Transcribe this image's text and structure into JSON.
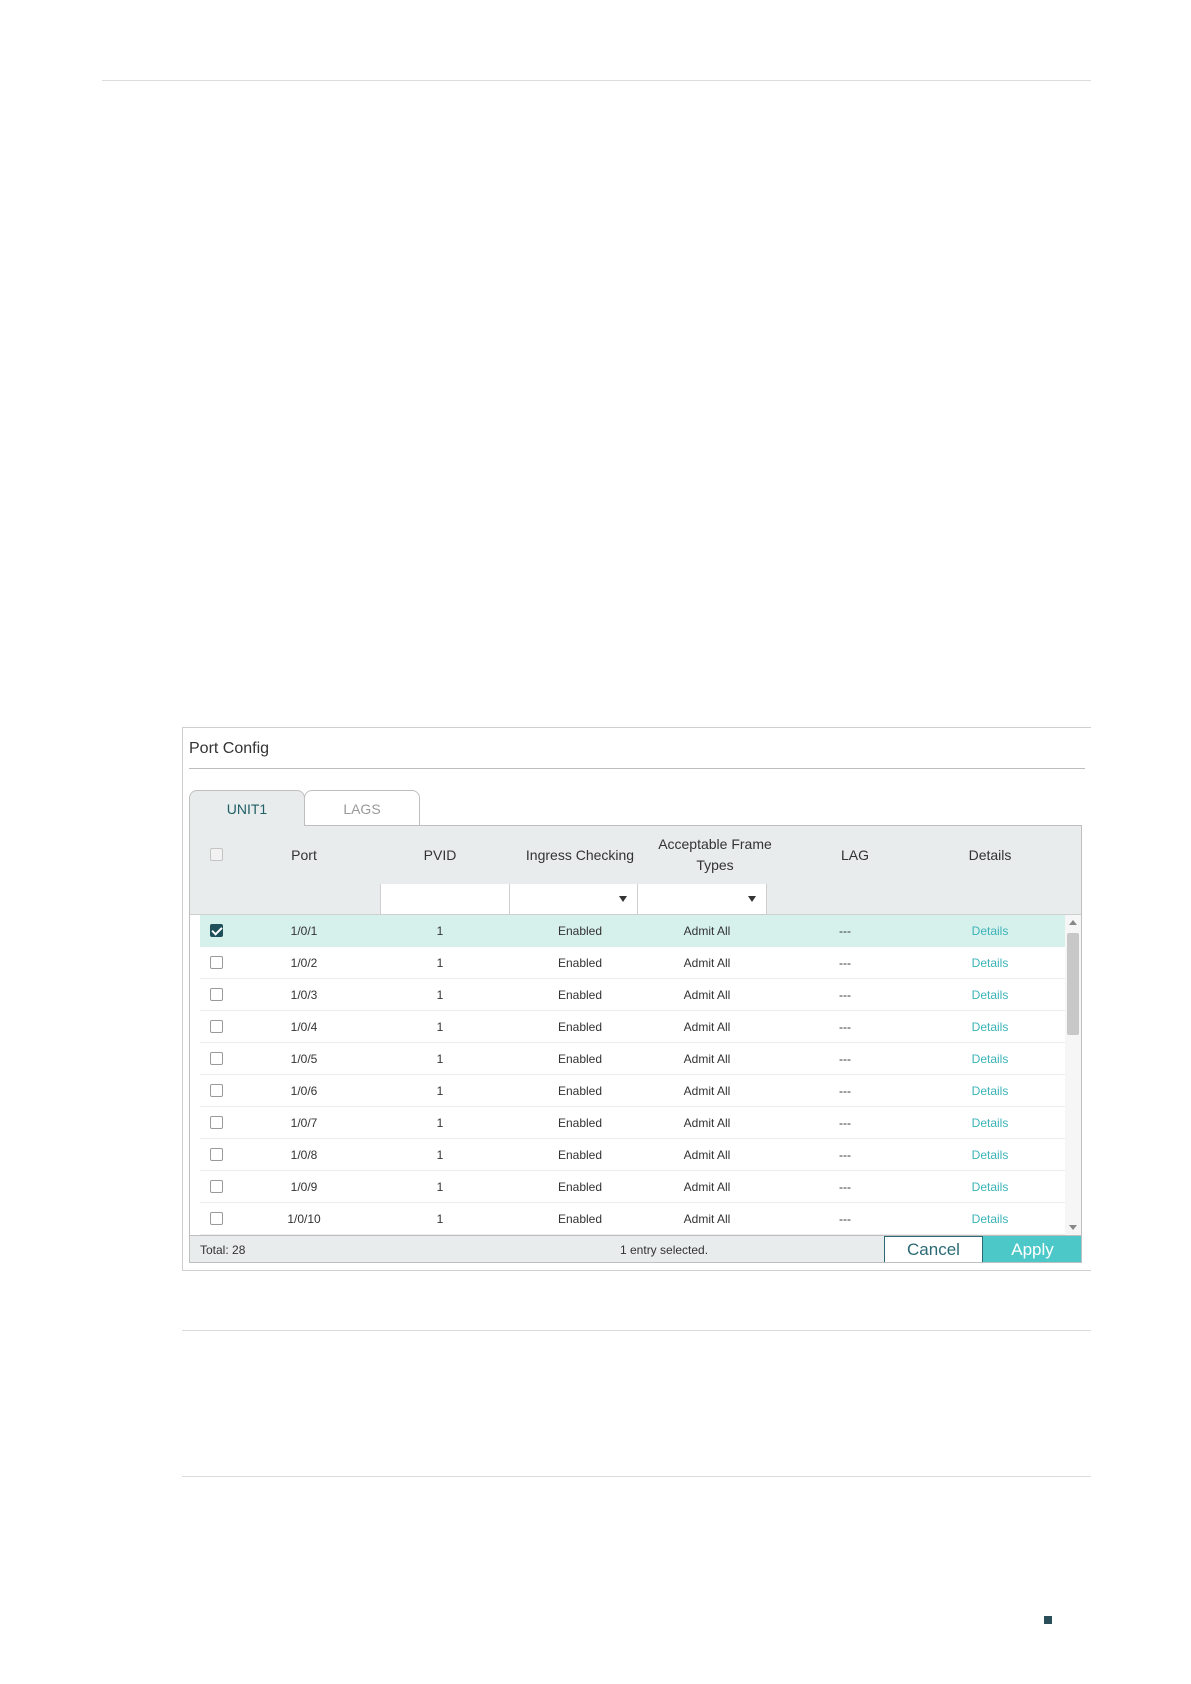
{
  "panel": {
    "title": "Port Config",
    "tabs": [
      {
        "label": "UNIT1",
        "active": true
      },
      {
        "label": "LAGS",
        "active": false
      }
    ]
  },
  "table": {
    "columns": [
      "Port",
      "PVID",
      "Ingress Checking",
      "Acceptable Frame Types",
      "LAG",
      "Details"
    ],
    "column_lines": {
      "acceptable_1": "Acceptable Frame",
      "acceptable_2": "Types"
    },
    "rows": [
      {
        "port": "1/0/1",
        "pvid": "1",
        "ingress": "Enabled",
        "frame": "Admit All",
        "lag": "---",
        "details": "Details",
        "checked": true
      },
      {
        "port": "1/0/2",
        "pvid": "1",
        "ingress": "Enabled",
        "frame": "Admit All",
        "lag": "---",
        "details": "Details",
        "checked": false
      },
      {
        "port": "1/0/3",
        "pvid": "1",
        "ingress": "Enabled",
        "frame": "Admit All",
        "lag": "---",
        "details": "Details",
        "checked": false
      },
      {
        "port": "1/0/4",
        "pvid": "1",
        "ingress": "Enabled",
        "frame": "Admit All",
        "lag": "---",
        "details": "Details",
        "checked": false
      },
      {
        "port": "1/0/5",
        "pvid": "1",
        "ingress": "Enabled",
        "frame": "Admit All",
        "lag": "---",
        "details": "Details",
        "checked": false
      },
      {
        "port": "1/0/6",
        "pvid": "1",
        "ingress": "Enabled",
        "frame": "Admit All",
        "lag": "---",
        "details": "Details",
        "checked": false
      },
      {
        "port": "1/0/7",
        "pvid": "1",
        "ingress": "Enabled",
        "frame": "Admit All",
        "lag": "---",
        "details": "Details",
        "checked": false
      },
      {
        "port": "1/0/8",
        "pvid": "1",
        "ingress": "Enabled",
        "frame": "Admit All",
        "lag": "---",
        "details": "Details",
        "checked": false
      },
      {
        "port": "1/0/9",
        "pvid": "1",
        "ingress": "Enabled",
        "frame": "Admit All",
        "lag": "---",
        "details": "Details",
        "checked": false
      },
      {
        "port": "1/0/10",
        "pvid": "1",
        "ingress": "Enabled",
        "frame": "Admit All",
        "lag": "---",
        "details": "Details",
        "checked": false
      }
    ]
  },
  "footer": {
    "total": "Total: 28",
    "selected": "1 entry selected.",
    "cancel_label": "Cancel",
    "apply_label": "Apply"
  },
  "colors": {
    "accent": "#4dc8c8",
    "link": "#3bb3b8",
    "selected_row": "#d6f0ec",
    "header_bg": "#e8ecec"
  }
}
